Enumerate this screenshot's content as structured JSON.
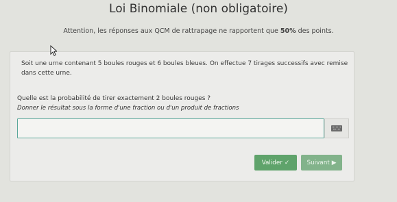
{
  "header": {
    "title": "Loi Binomiale (non obligatoire)"
  },
  "notice": {
    "before": "Attention, les réponses aux QCM de rattrapage ne rapportent que ",
    "highlight": "50%",
    "after": " des points."
  },
  "exercise": {
    "statement": "Soit une urne contenant 5 boules rouges et 6 boules bleues. On effectue 7 tirages successifs avec remise dans cette urne.",
    "question": "Quelle est la probabilité de tirer exactement 2 boules rouges ?",
    "instruction": "Donner le résultat sous la forme d'une fraction ou d'un produit de fractions"
  },
  "answer": {
    "value": "",
    "keyboard_icon": "keyboard-icon"
  },
  "actions": {
    "validate_label": "Valider",
    "validate_icon": "check-icon",
    "next_label": "Suivant",
    "next_icon": "play-icon"
  },
  "colors": {
    "validate": "#5fa36b",
    "next": "#82b38b",
    "input_border": "#5aa79a"
  }
}
